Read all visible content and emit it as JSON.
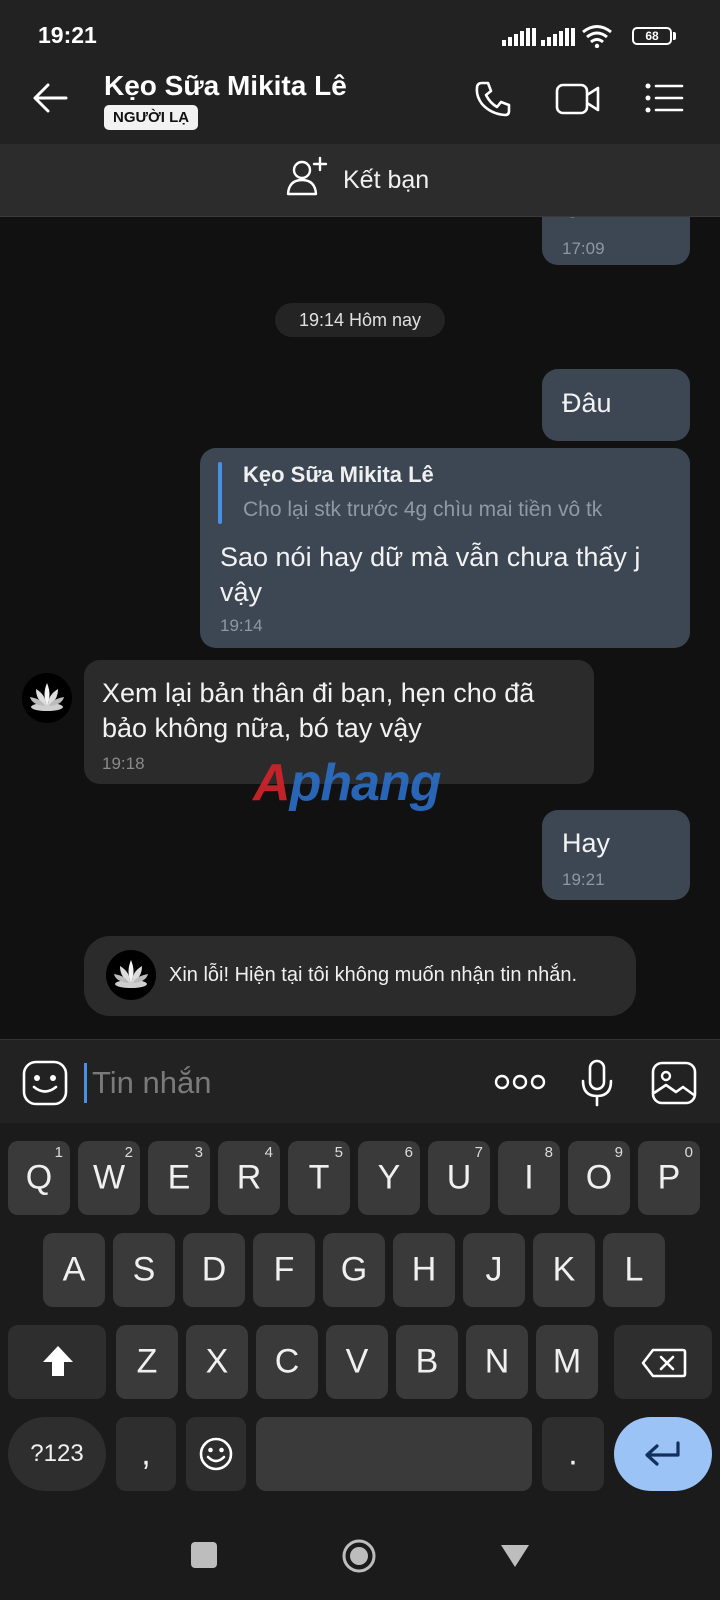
{
  "status": {
    "time": "19:21",
    "battery": "68"
  },
  "header": {
    "name": "Kẹo Sữa Mikita Lê",
    "badge": "NGƯỜI LẠ"
  },
  "add_friend": {
    "label": "Kết bạn"
  },
  "chat": {
    "prev_partial": {
      "text": "OK",
      "time": "17:09"
    },
    "date_separator": "19:14 Hôm nay",
    "msg1": {
      "text": "Đâu"
    },
    "reply": {
      "quote_name": "Kẹo Sữa Mikita Lê",
      "quote_text": "Cho lại stk trước 4g chìu mai tiền vô tk",
      "text": "Sao nói hay dữ mà vẫn chưa thấy j vậy",
      "time": "19:14"
    },
    "incoming": {
      "text": "Xem lại bản thân đi bạn, hẹn cho đã bảo không nữa, bó tay vậy",
      "time": "19:18"
    },
    "msg_hay": {
      "text": "Hay",
      "time": "19:21"
    },
    "auto_reply": {
      "text": "Xin lỗi! Hiện tại tôi không muốn nhận tin nhắn."
    },
    "watermark": "Aphang"
  },
  "input": {
    "placeholder": "Tin nhắn"
  },
  "keyboard": {
    "row1": [
      {
        "k": "Q",
        "h": "1"
      },
      {
        "k": "W",
        "h": "2"
      },
      {
        "k": "E",
        "h": "3"
      },
      {
        "k": "R",
        "h": "4"
      },
      {
        "k": "T",
        "h": "5"
      },
      {
        "k": "Y",
        "h": "6"
      },
      {
        "k": "U",
        "h": "7"
      },
      {
        "k": "I",
        "h": "8"
      },
      {
        "k": "O",
        "h": "9"
      },
      {
        "k": "P",
        "h": "0"
      }
    ],
    "row2": [
      "A",
      "S",
      "D",
      "F",
      "G",
      "H",
      "J",
      "K",
      "L"
    ],
    "row3": [
      "Z",
      "X",
      "C",
      "V",
      "B",
      "N",
      "M"
    ],
    "symbols": "?123",
    "comma": ",",
    "period": "."
  },
  "colors": {
    "accent": "#4a90e2",
    "outgoing_bubble": "#3d4754",
    "incoming_bubble": "#2b2b2b",
    "enter_key": "#9cc3f5"
  }
}
